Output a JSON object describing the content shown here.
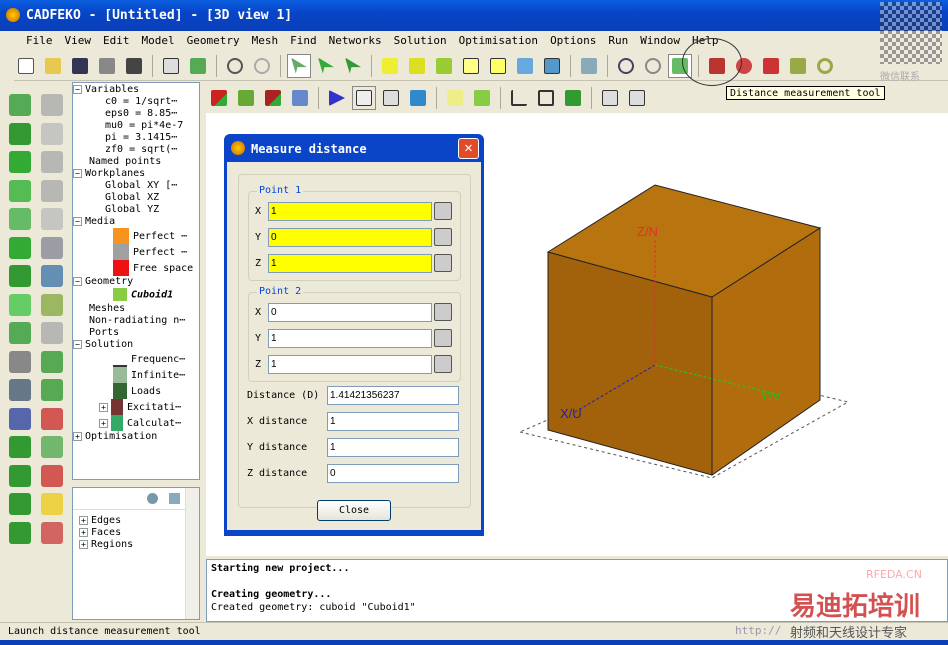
{
  "window": {
    "title": "CADFEKO - [Untitled] - [3D view 1]"
  },
  "menu": [
    "File",
    "View",
    "Edit",
    "Model",
    "Geometry",
    "Mesh",
    "Find",
    "Networks",
    "Solution",
    "Optimisation",
    "Options",
    "Run",
    "Window",
    "Help"
  ],
  "tooltip": "Distance measurement tool",
  "tree": {
    "variables": {
      "label": "Variables",
      "items": [
        "c0 = 1/sqrt⋯",
        "eps0 = 8.85⋯",
        "mu0 = pi*4e-7",
        "pi = 3.1415⋯",
        "zf0 = sqrt(⋯"
      ]
    },
    "named_points": "Named points",
    "workplanes": {
      "label": "Workplanes",
      "items": [
        "Global XY [⋯",
        "Global XZ",
        "Global YZ"
      ]
    },
    "media": {
      "label": "Media",
      "items": [
        {
          "label": "Perfect ⋯",
          "color": "#f7941d"
        },
        {
          "label": "Perfect ⋯",
          "color": "#a0a0a0"
        },
        {
          "label": "Free space",
          "color": "#ee1111"
        }
      ]
    },
    "geometry": {
      "label": "Geometry",
      "items": [
        "Cuboid1"
      ]
    },
    "meshes": "Meshes",
    "non_radiating": "Non-radiating n⋯",
    "ports": "Ports",
    "solution": {
      "label": "Solution",
      "items": [
        "Frequenc⋯",
        "Infinite⋯",
        "Loads",
        "Excitati⋯",
        "Calculat⋯"
      ]
    },
    "optimisation": "Optimisation"
  },
  "details_tree": [
    "Edges",
    "Faces",
    "Regions"
  ],
  "dialog": {
    "title": "Measure distance",
    "point1": {
      "label": "Point 1",
      "x": "1",
      "y": "0",
      "z": "1"
    },
    "point2": {
      "label": "Point 2",
      "x": "0",
      "y": "1",
      "z": "1"
    },
    "axis_labels": {
      "x": "X",
      "y": "Y",
      "z": "Z"
    },
    "distance_label": "Distance (D)",
    "distance": "1.41421356237",
    "x_distance_label": "X distance",
    "x_distance": "1",
    "y_distance_label": "Y distance",
    "y_distance": "1",
    "z_distance_label": "Z distance",
    "z_distance": "0",
    "close": "Close"
  },
  "view": {
    "axis_z": "Z/N",
    "axis_x": "X/U",
    "axis_y": "Y/V",
    "cube_color": "#b7700f"
  },
  "log": [
    "Starting new project...",
    "",
    "Creating geometry...",
    "Created geometry: cuboid \"Cuboid1\""
  ],
  "status": "Launch distance measurement tool",
  "watermark": {
    "brand": "RFEDA.CN",
    "cn1": "易迪拓培训",
    "cn2": "射频和天线设计专家",
    "url": "http://",
    "wechat": "微信联系"
  }
}
